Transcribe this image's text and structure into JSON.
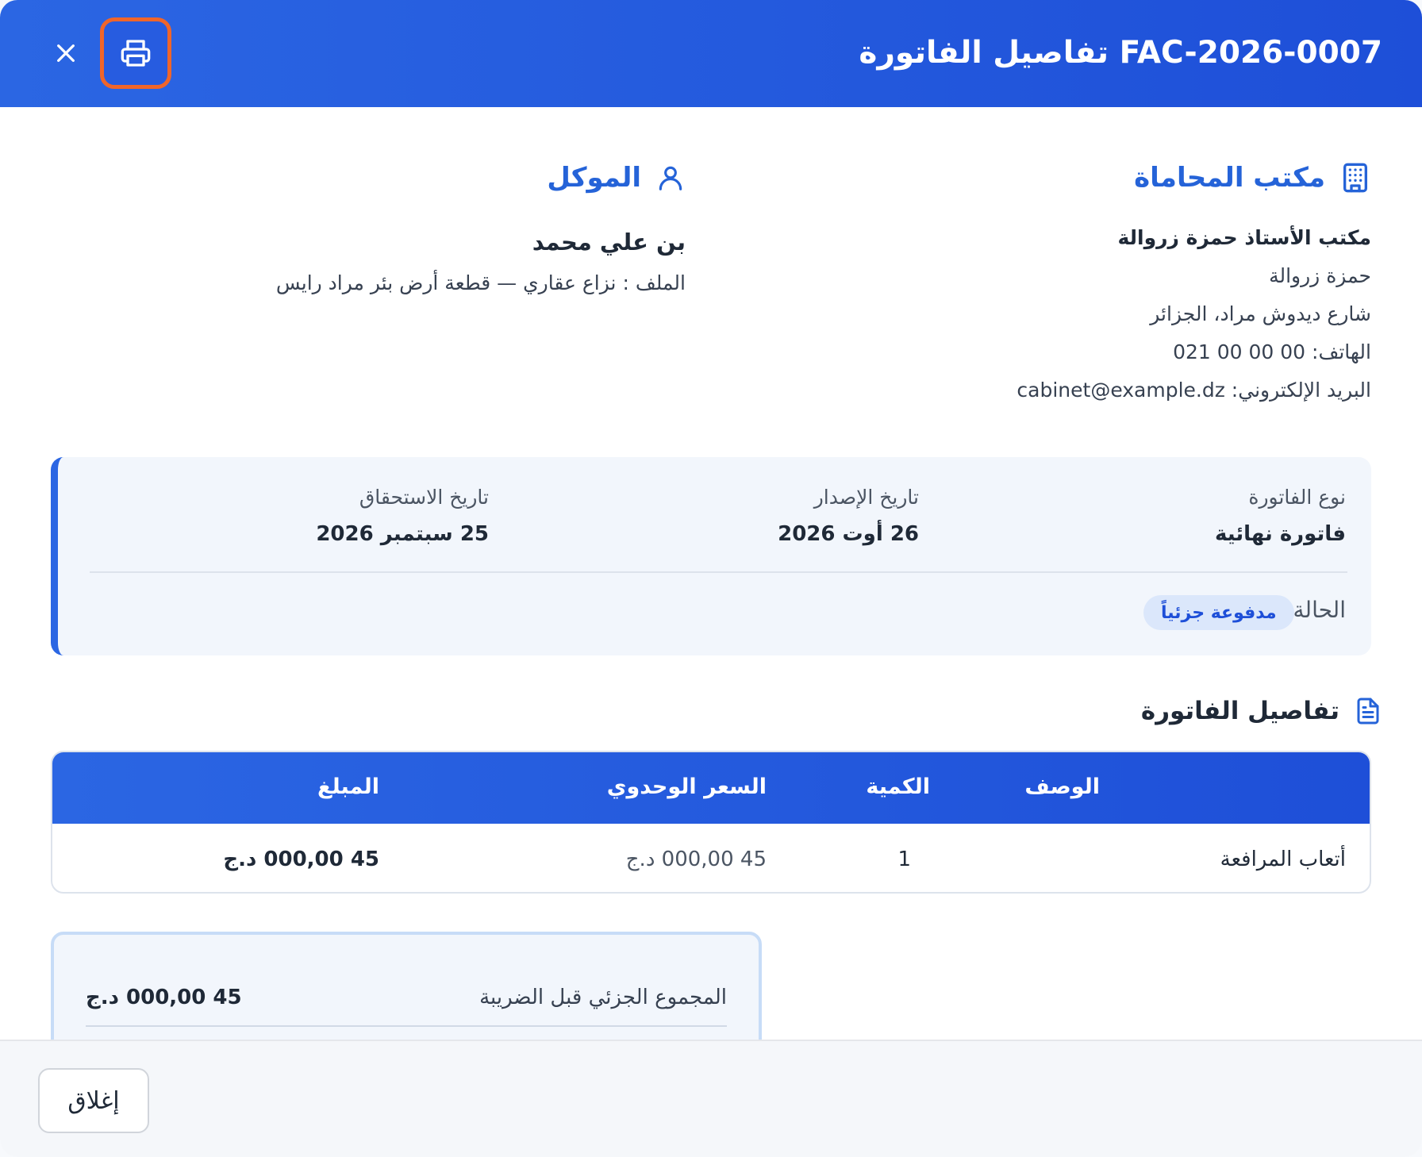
{
  "header": {
    "title": "FAC-2026-0007 تفاصيل الفاتورة",
    "print_icon": "printer-icon",
    "close_icon": "close-icon"
  },
  "office": {
    "section_label": "مكتب المحاماة",
    "name": "مكتب الأستاذ حمزة زروالة",
    "contact": "حمزة زروالة",
    "address": "شارع ديدوش مراد، الجزائر",
    "phone": "الهاتف: 00 00 00 021",
    "email": "البريد الإلكتروني: cabinet@example.dz"
  },
  "client": {
    "section_label": "الموكل",
    "name": "بن علي محمد",
    "file": "الملف : نزاع عقاري — قطعة أرض بئر مراد رايس"
  },
  "info": {
    "type_label": "نوع الفاتورة",
    "type_value": "فاتورة نهائية",
    "issue_label": "تاريخ الإصدار",
    "issue_value": "26 أوت 2026",
    "due_label": "تاريخ الاستحقاق",
    "due_value": "25 سبتمبر 2026",
    "status_label": "الحالة :",
    "status_value": "مدفوعة جزئياً"
  },
  "details": {
    "section_label": "تفاصيل الفاتورة",
    "columns": [
      "الوصف",
      "الكمية",
      "السعر الوحدوي",
      "المبلغ"
    ],
    "rows": [
      {
        "description": "أتعاب المرافعة",
        "quantity": "1",
        "unit_price": "45 000,00 د.ج",
        "amount": "45 000,00 د.ج"
      }
    ]
  },
  "summary": {
    "subtotal_label": "المجموع الجزئي قبل الضريبة",
    "subtotal_value": "45 000,00 د.ج"
  },
  "footer": {
    "close_label": "إغلاق"
  },
  "colors": {
    "accent": "#2b66e3",
    "print_focus": "#f0652a",
    "badge_bg": "#dbe7fb"
  }
}
